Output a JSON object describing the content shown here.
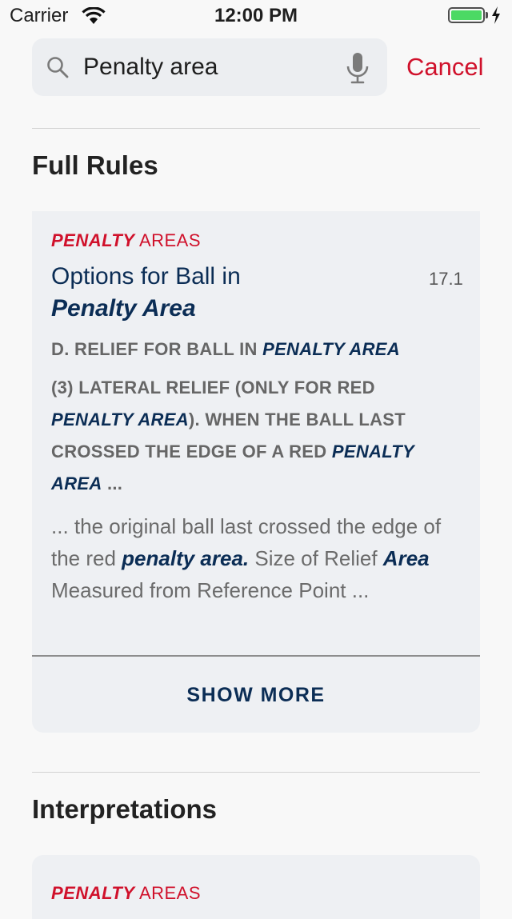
{
  "status_bar": {
    "carrier": "Carrier",
    "time": "12:00 PM",
    "battery_level": 1.0
  },
  "search": {
    "value": "Penalty area",
    "placeholder": "Search",
    "cancel_label": "Cancel"
  },
  "sections": {
    "full_rules": {
      "title": "Full Rules",
      "card": {
        "category_em": "PENALTY",
        "category_rest": " AREAS",
        "title_plain": "Options for Ball in ",
        "title_em": "Penalty Area",
        "rule_number": "17.1",
        "subhead_prefix": "D. RELIEF FOR BALL IN ",
        "subhead_em": "PENALTY AREA",
        "body_prefix": "(3) LATERAL RELIEF (ONLY FOR RED ",
        "body_em1": "PENALTY AREA",
        "body_middle": "). WHEN THE BALL LAST CROSSED THE EDGE OF A RED ",
        "body_em2": "PENALTY AREA",
        "body_suffix": " ...",
        "excerpt_part1": "... the original ball last crossed the edge of the red ",
        "excerpt_em1": "penalty area.",
        "excerpt_part2": " Size of Relief ",
        "excerpt_em2": "Area",
        "excerpt_part3": " Measured from Reference Point ...",
        "show_more_label": "SHOW MORE"
      }
    },
    "interpretations": {
      "title": "Interpretations",
      "card": {
        "category_em": "PENALTY",
        "category_rest": " AREAS"
      }
    }
  },
  "colors": {
    "accent": "#d0112b",
    "navy": "#0b2d55",
    "card_bg": "#eef0f3"
  }
}
